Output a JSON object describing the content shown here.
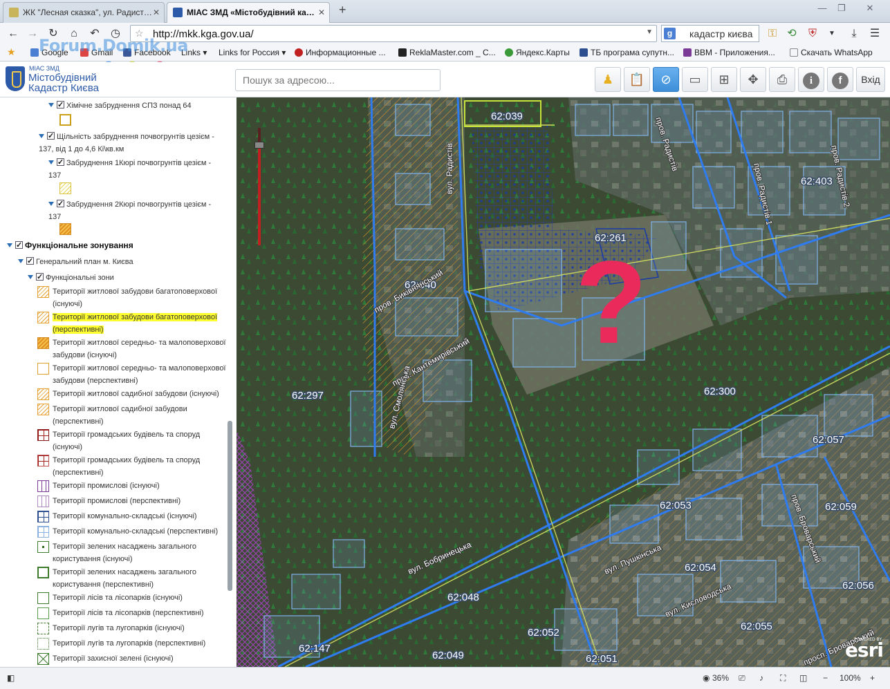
{
  "tabs": [
    {
      "title": "ЖК \"Лесная сказка\", ул. Радист…",
      "active": false
    },
    {
      "title": "МІАС ЗМД «Містобудівний ка…",
      "active": true
    }
  ],
  "nav": {
    "url": "http://mkk.kga.gov.ua/",
    "search_query": "кадастр києва"
  },
  "bookmarks": [
    "Google",
    "Gmail",
    "Facebook",
    "Links",
    "Links for Россия",
    "Информационные ...",
    "ReklaMaster.com _ C...",
    "Яндекс.Карты",
    "ТБ програма супутн...",
    "BBM - Приложения...",
    "Скачать WhatsApp"
  ],
  "watermark": "Forum.Domik.ua",
  "app": {
    "logo_small": "МІАС ЗМД",
    "logo_line1": "Містобудівний",
    "logo_line2": "Кадастр Києва",
    "address_placeholder": "Пошук за адресою...",
    "tools": [
      "pegman-icon",
      "clipboard-icon",
      "identify-icon",
      "ruler-icon",
      "layers-icon",
      "pan-icon",
      "print-icon",
      "info-icon",
      "facebook-icon"
    ],
    "exit_label": "Вхід"
  },
  "sidebar": {
    "layers": [
      "Хімічне забруднення СПЗ понад 64",
      "Щільність забруднення почвогрунтів цезієм - 137, від 1 до 4,6 Кі\\кв.км",
      "Забруднення 1Кюрі почвогрунтів цезієм - 137",
      "Забруднення 2Кюрі почвогрунтів цезієм - 137",
      "Функціональне зонування",
      "Генеральний план м. Києва",
      "Функціональні зони"
    ],
    "legend": [
      "Території житлової забудови багатоповерхової (існуючі)",
      "Території житлової забудови багатоповерхової (перспективні)",
      "Території житлової середньо- та малоповерхової забудови (існуючі)",
      "Території житлової середньо- та малоповерхової забудови (перспективні)",
      "Території житлової садибної забудови (існуючі)",
      "Території житлової садибної забудови (перспективні)",
      "Території громадських будівель та споруд (існуючі)",
      "Території громадських будівель та споруд (перспективні)",
      "Території промислові (існуючі)",
      "Території промислові (перспективні)",
      "Території комунально-складські (існуючі)",
      "Території комунально-складські (перспективні)",
      "Території зелених насаджень загального користування (існуючі)",
      "Території зелених насаджень загального користування (перспективні)",
      "Території лісів та лісопарків (існуючі)",
      "Території лісів та лісопарків (перспективні)",
      "Території лугів та лугопарків (існуючі)",
      "Території лугів та лугопарків (перспективні)",
      "Території захисної зелені (існуючі)"
    ]
  },
  "map": {
    "parcels": [
      "62:039",
      "62:403",
      "62:261",
      "62:040",
      "62:297",
      "62:300",
      "62:057",
      "62:053",
      "62:059",
      "62:054",
      "62:056",
      "62:048",
      "62:055",
      "62:052",
      "62:147",
      "62:049",
      "62:051"
    ],
    "streets": [
      "вул. Радистів",
      "пров. Радистів",
      "пров. Радистів 1",
      "пров. Радистів 2",
      "пров. Биківнянський",
      "пров. Кантемирівський",
      "вул. Смолянська",
      "вул. Пушкінська",
      "вул. Кисловодська",
      "пров. Броварський",
      "просп. Броварський",
      "вул. Бобринецька"
    ],
    "mark": "?",
    "esri_powered": "POWERED BY",
    "esri": "esri"
  },
  "status": {
    "zoom_percent": "36%",
    "page_zoom": "100%"
  }
}
